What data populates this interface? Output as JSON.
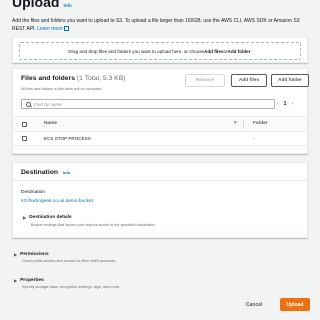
{
  "header": {
    "title": "Upload",
    "info": "Info",
    "description": "Add the files and folders you want to upload to S3. To upload a file larger than 160GB, use the AWS CLI, AWS SDK or Amazon S3 REST API.",
    "learn_more": "Learn more"
  },
  "dropzone": {
    "text_before": "Drag and drop files and folders you want to upload here, or choose ",
    "add_files": "Add files",
    "text_or": " or ",
    "add_folder": "Add folder",
    "text_after": "."
  },
  "files": {
    "title": "Files and folders",
    "count": "(1 Total, 5.3 KB)",
    "subtitle": "All files and folders in this table will be uploaded.",
    "remove_label": "Remove",
    "add_files_label": "Add files",
    "add_folder_label": "Add folder",
    "search_placeholder": "Find by name",
    "page": "1",
    "columns": {
      "name": "Name",
      "folder": "Folder"
    },
    "rows": [
      {
        "name": "ECS STOP PROCESS",
        "folder": "-"
      }
    ]
  },
  "destination": {
    "title": "Destination",
    "info": "Info",
    "label": "Destination",
    "url": "s3://turbogeek.co.uk.demo.bucket",
    "details_title": "Destination details",
    "details_desc": "Bucket settings that impact new objects stored in the specified destination."
  },
  "permissions": {
    "title": "Permissions",
    "desc": "Grant public access and access to other AWS accounts."
  },
  "properties": {
    "title": "Properties",
    "desc": "Specify storage class, encryption settings, tags, and more."
  },
  "footer": {
    "cancel": "Cancel",
    "upload": "Upload"
  },
  "icons": {
    "search": "search-icon",
    "external": "external-link-icon",
    "caret": "caret-right-icon",
    "sort": "sort-down-icon"
  },
  "colors": {
    "accent": "#0073bb",
    "primary_button": "#ec7211",
    "background": "#f2f3f3"
  }
}
